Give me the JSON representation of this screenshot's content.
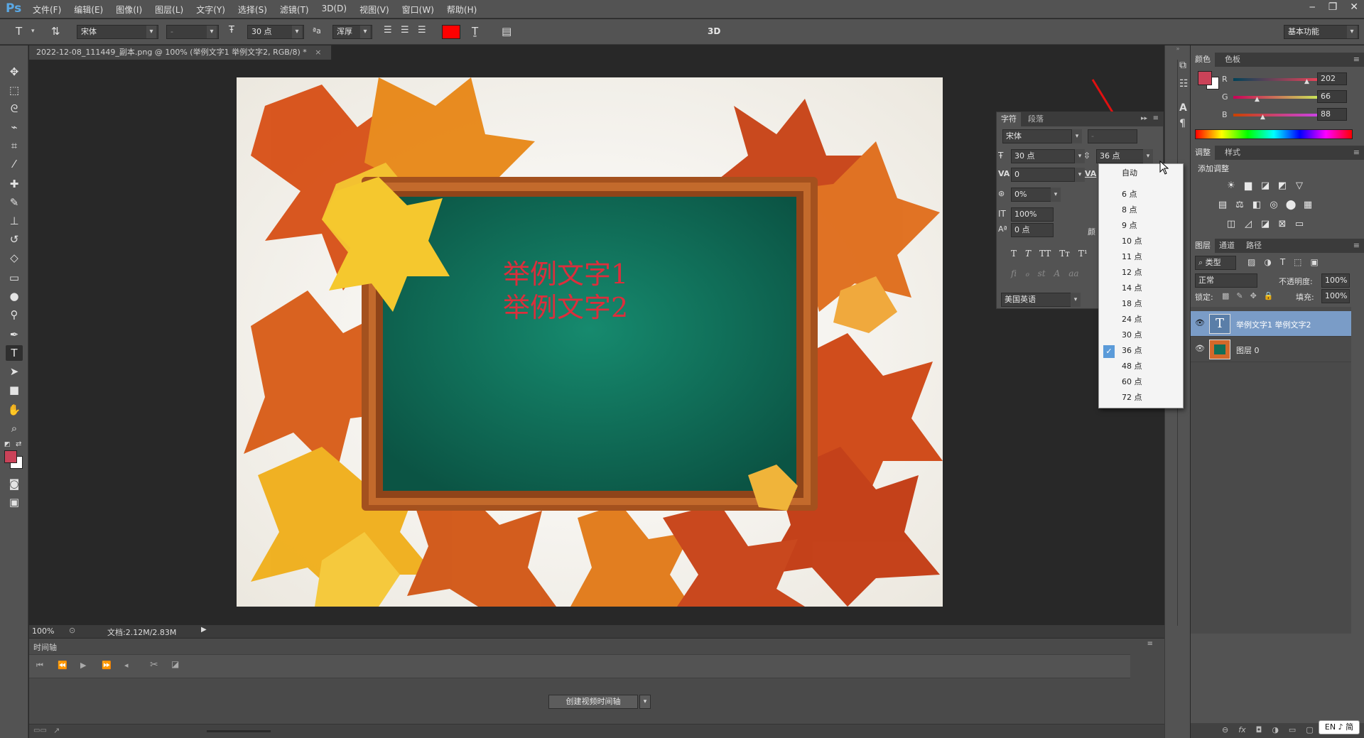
{
  "app": {
    "logo": "Ps",
    "menus": [
      "文件(F)",
      "编辑(E)",
      "图像(I)",
      "图层(L)",
      "文字(Y)",
      "选择(S)",
      "滤镜(T)",
      "3D(D)",
      "视图(V)",
      "窗口(W)",
      "帮助(H)"
    ],
    "window_controls": [
      "‒",
      "❐",
      "✕"
    ]
  },
  "options_bar": {
    "tool_glyph": "T",
    "font_family": "宋体",
    "font_style": "-",
    "font_size": "30 点",
    "aa_glyph": "ªa",
    "antialias": "浑厚",
    "text_color": "#ff0000",
    "mode_3d": "3D",
    "workspace": "基本功能"
  },
  "document": {
    "tab_title": "2022-12-08_111449_副本.png @ 100% (举例文字1 举例文字2, RGB/8) *",
    "text_line1": "举例文字1",
    "text_line2": "举例文字2",
    "text_color": "#dc2e3c",
    "board_color": "#0f6b55",
    "frame_color": "#b55a22"
  },
  "status": {
    "zoom": "100%",
    "doc_info": "文档:2.12M/2.83M"
  },
  "timeline": {
    "title": "时间轴",
    "create_button": "创建视频时间轴"
  },
  "character_panel": {
    "tabs": [
      "字符",
      "段落"
    ],
    "font_family": "宋体",
    "font_style": "-",
    "size": "30 点",
    "leading": "36 点",
    "kerning": "0",
    "tracking": "0%",
    "vertical_scale": "100%",
    "baseline_shift": "0 点",
    "color_label": "颜",
    "language": "美国英语",
    "style_buttons": [
      "T",
      "T",
      "TT",
      "Tт",
      "T¹"
    ],
    "opentype_buttons": [
      "fi",
      "ℴ",
      "st",
      "A",
      "aa"
    ]
  },
  "leading_dropdown": {
    "options": [
      "自动",
      "6 点",
      "8 点",
      "9 点",
      "10 点",
      "11 点",
      "12 点",
      "14 点",
      "18 点",
      "24 点",
      "30 点",
      "36 点",
      "48 点",
      "60 点",
      "72 点"
    ],
    "selected": "36 点"
  },
  "color_panel": {
    "tabs": [
      "颜色",
      "色板"
    ],
    "r_label": "R",
    "g_label": "G",
    "b_label": "B",
    "r": 202,
    "g": 66,
    "b": 88,
    "foreground": "#ca4258",
    "background": "#ffffff"
  },
  "adjustments_panel": {
    "tabs": [
      "调整",
      "样式"
    ],
    "title": "添加调整",
    "icons_row1": [
      "☀",
      "▆",
      "◪",
      "◩",
      "▽"
    ],
    "icons_row2": [
      "▤",
      "⚖",
      "◧",
      "◎",
      "⬤",
      "▦"
    ],
    "icons_row3": [
      "◫",
      "◿",
      "◪",
      "⊠",
      "▭"
    ]
  },
  "layers_panel": {
    "tabs": [
      "图层",
      "通道",
      "路径"
    ],
    "filter": "类型",
    "blend_mode": "正常",
    "opacity_label": "不透明度:",
    "opacity": "100%",
    "lock_label": "锁定:",
    "fill_label": "填充:",
    "fill": "100%",
    "layers": [
      {
        "name": "举例文字1 举例文字2",
        "type": "text",
        "selected": true
      },
      {
        "name": "图层 0",
        "type": "image",
        "selected": false
      }
    ],
    "bottom_icons": [
      "⊖",
      "fx",
      "◘",
      "◑",
      "▭",
      "▢",
      "🗑"
    ]
  },
  "ime": {
    "label": "EN ♪ 简"
  }
}
